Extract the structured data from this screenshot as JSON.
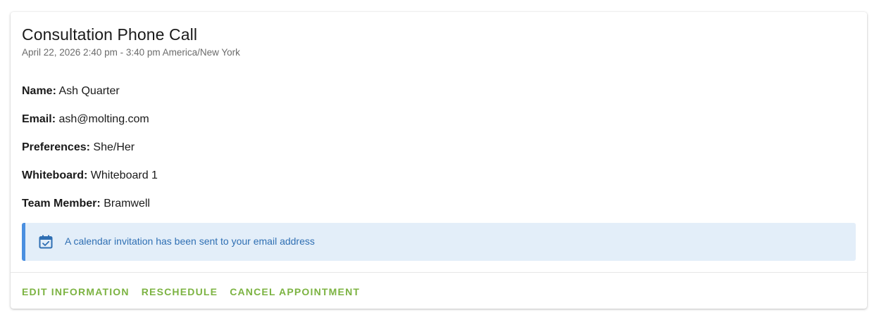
{
  "appointment": {
    "title": "Consultation Phone Call",
    "datetime": "April 22, 2026 2:40 pm - 3:40 pm America/New York"
  },
  "details": [
    {
      "label": "Name:",
      "value": "Ash Quarter"
    },
    {
      "label": "Email:",
      "value": "ash@molting.com"
    },
    {
      "label": "Preferences:",
      "value": "She/Her"
    },
    {
      "label": "Whiteboard:",
      "value": "Whiteboard 1"
    },
    {
      "label": "Team Member:",
      "value": "Bramwell"
    }
  ],
  "alert": {
    "icon": "calendar-check-icon",
    "message": "A calendar invitation has been sent to your email address",
    "accent_color": "#4a8fe0",
    "background_color": "#e3eef9"
  },
  "actions": {
    "edit_label": "EDIT INFORMATION",
    "reschedule_label": "RESCHEDULE",
    "cancel_label": "CANCEL APPOINTMENT",
    "color": "#7cb342"
  }
}
